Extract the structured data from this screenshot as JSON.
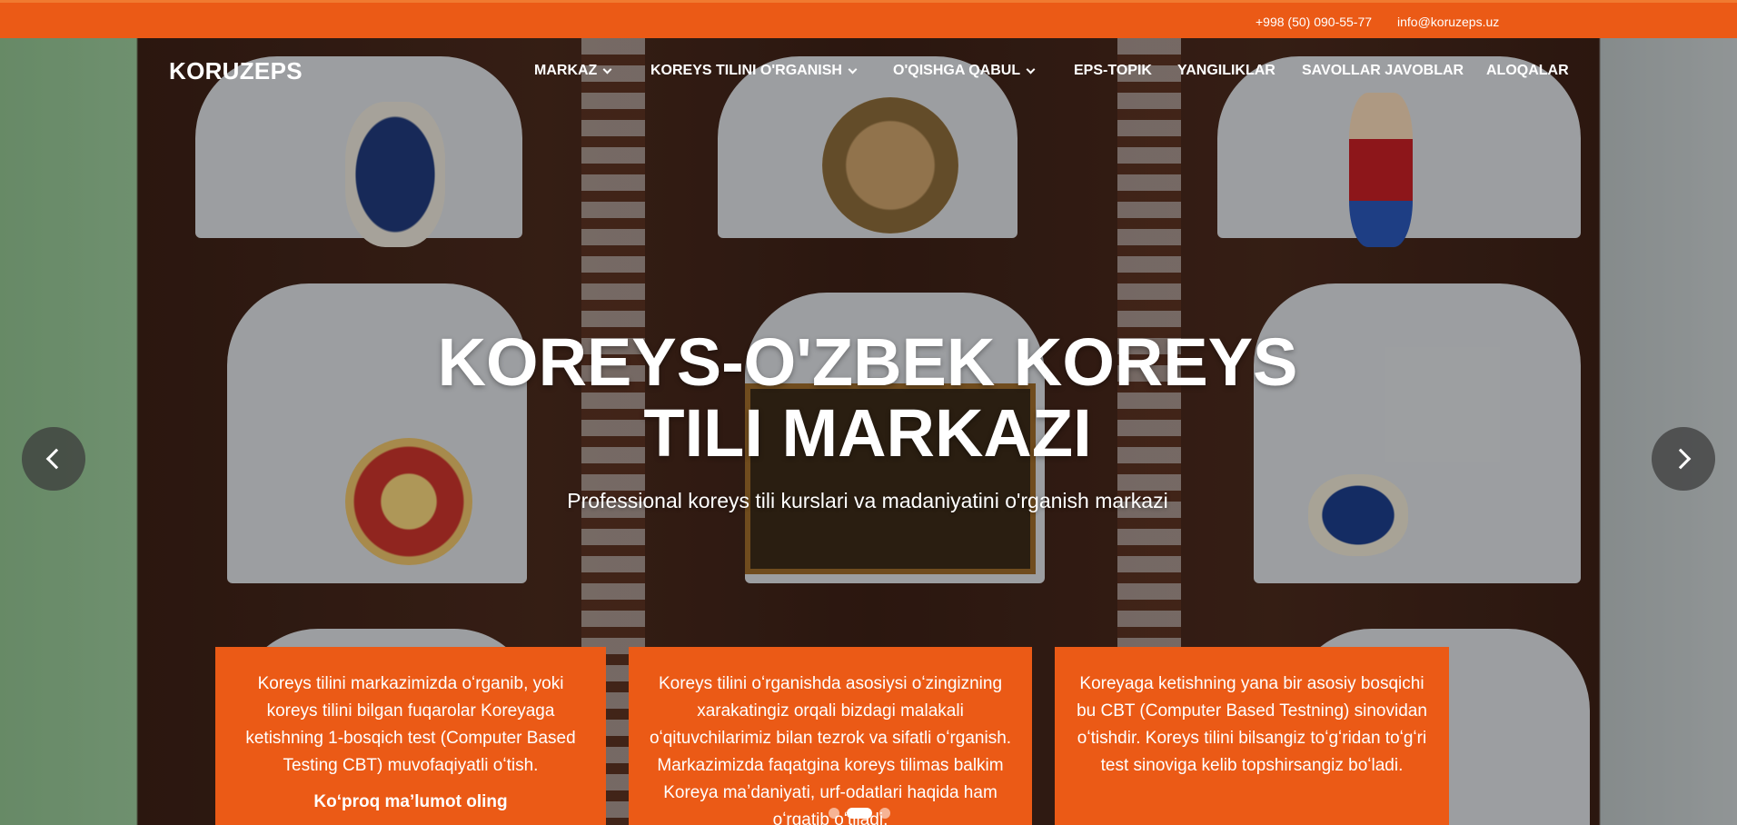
{
  "topbar": {
    "phone": "+998 (50) 090-55-77",
    "email": "info@koruzeps.uz",
    "bg_color": "#eb5a16"
  },
  "header": {
    "logo": "KORUZEPS",
    "nav": [
      {
        "label": "MARKAZ",
        "dropdown": true
      },
      {
        "label": "KOREYS TILINI O'RGANISH",
        "dropdown": true
      },
      {
        "label": "O'QISHGA QABUL",
        "dropdown": true
      },
      {
        "label": "EPS-TOPIK",
        "dropdown": false
      },
      {
        "label": "YANGILIKLAR",
        "dropdown": false
      },
      {
        "label": "SAVOLLAR JAVOBLAR",
        "dropdown": false
      },
      {
        "label": "ALOQALAR",
        "dropdown": false
      }
    ]
  },
  "hero": {
    "title_line1": "KOREYS-O'ZBEK KOREYS",
    "title_line2": "TILI MARKAZI",
    "subtitle": "Professional koreys tili kurslari va madaniyatini o'rganish markazi",
    "prev_icon": "chevron-left-icon",
    "next_icon": "chevron-right-icon"
  },
  "cards": [
    {
      "text": "Koreys tilini markazimizda oʻrganib, yoki koreys tilini bilgan fuqarolar Koreyaga ketishning 1-bosqich test (Computer Based Testing CBT) muvofaqiyatli oʻtish.",
      "link": "Koʻproq maʼlumot oling"
    },
    {
      "text": "Koreys tilini oʻrganishda asosiysi oʻzingizning xarakatingiz orqali bizdagi malakali oʻqituvchilarimiz bilan tezrok va sifatli oʻrganish. Markazimizda faqatgina koreys tilimas balkim Koreya maʼdaniyati, urf-odatlari haqida ham oʻrgatib oʻtiladi.",
      "link": ""
    },
    {
      "text": "Koreyaga ketishning yana bir asosiy bosqichi bu CBT (Computer Based Testning) sinovidan oʻtishdir. Koreys tilini bilsangiz toʻgʻridan toʻgʻri test sinoviga kelib topshirsangiz boʻladi.",
      "link": ""
    }
  ],
  "carousel": {
    "slide_count": 3,
    "active_index": 1
  }
}
